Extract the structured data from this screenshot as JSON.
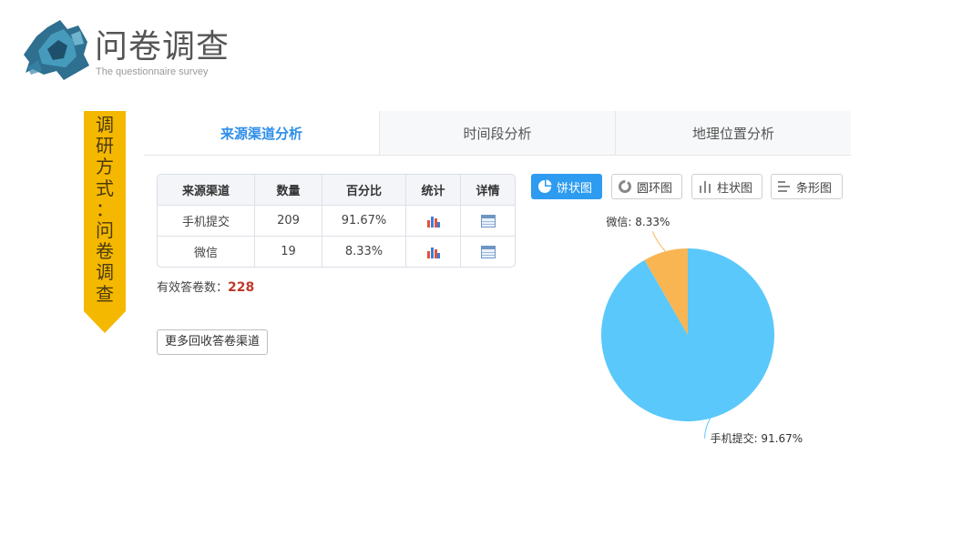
{
  "header": {
    "title": "问卷调查",
    "subtitle": "The questionnaire survey"
  },
  "ribbon": {
    "chars": [
      "调",
      "研",
      "方",
      "式",
      "：",
      "问",
      "卷",
      "调",
      "查"
    ]
  },
  "tabs": [
    {
      "label": "来源渠道分析",
      "active": true
    },
    {
      "label": "时间段分析",
      "active": false
    },
    {
      "label": "地理位置分析",
      "active": false
    }
  ],
  "table": {
    "headers": [
      "来源渠道",
      "数量",
      "百分比",
      "统计",
      "详情"
    ],
    "rows": [
      {
        "channel": "手机提交",
        "count": "209",
        "percent": "91.67%"
      },
      {
        "channel": "微信",
        "count": "19",
        "percent": "8.33%"
      }
    ]
  },
  "summary": {
    "label": "有效答卷数：",
    "value": "228"
  },
  "more_button": "更多回收答卷渠道",
  "chart_types": [
    {
      "label": "饼状图",
      "icon": "pie-icon",
      "active": true
    },
    {
      "label": "圆环图",
      "icon": "donut-icon",
      "active": false
    },
    {
      "label": "柱状图",
      "icon": "bar-icon",
      "active": false
    },
    {
      "label": "条形图",
      "icon": "hbar-icon",
      "active": false
    }
  ],
  "colors": {
    "accent": "#2d9cf0",
    "mobile": "#5ac8fa",
    "wechat": "#f8b552",
    "ribbon": "#f5b800"
  },
  "chart_data": {
    "type": "pie",
    "slices": [
      {
        "name": "手机提交",
        "value": 91.67,
        "label": "手机提交: 91.67%",
        "color": "#5ac8fa"
      },
      {
        "name": "微信",
        "value": 8.33,
        "label": "微信: 8.33%",
        "color": "#f8b552"
      }
    ]
  }
}
